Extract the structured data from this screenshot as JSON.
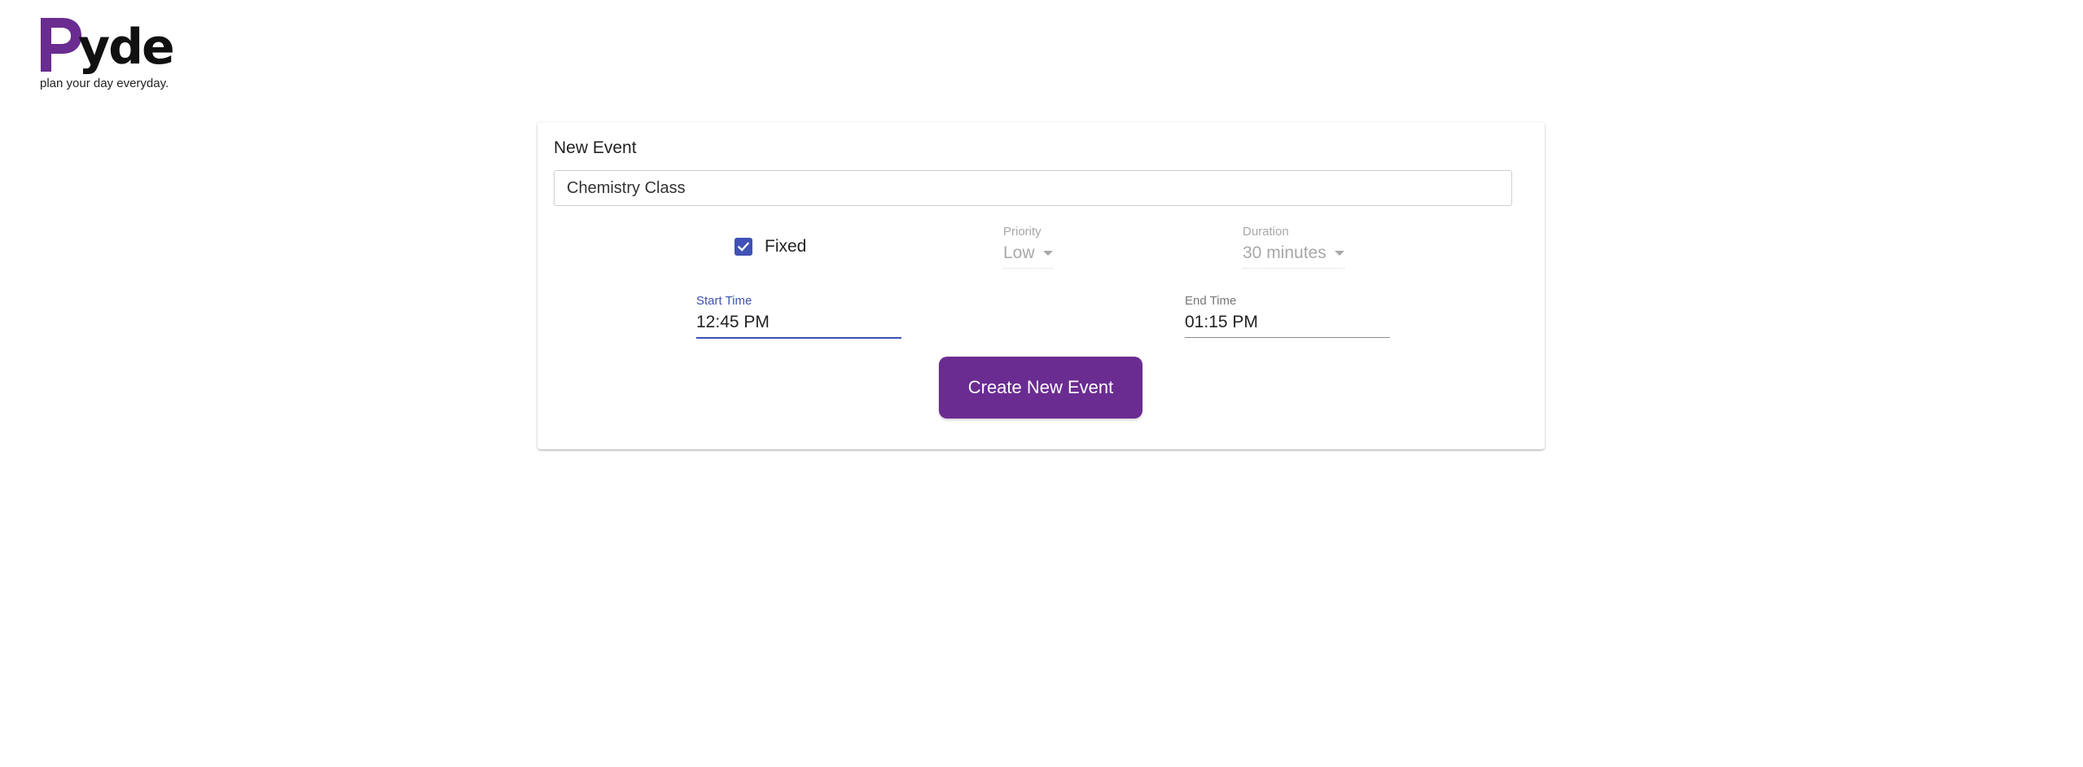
{
  "brand": {
    "logo_initial": "P",
    "logo_rest": "yde",
    "tagline": "plan your day everyday.",
    "accent_color": "#6a2c91"
  },
  "event_form": {
    "title": "New Event",
    "name_value": "Chemistry Class",
    "fixed": {
      "label": "Fixed",
      "checked": true
    },
    "priority": {
      "label": "Priority",
      "value": "Low"
    },
    "duration": {
      "label": "Duration",
      "value": "30 minutes"
    },
    "start_time": {
      "label": "Start Time",
      "value": "12:45 PM"
    },
    "end_time": {
      "label": "End Time",
      "value": "01:15 PM"
    },
    "submit_label": "Create New Event",
    "focus_color": "#3f51b5"
  }
}
